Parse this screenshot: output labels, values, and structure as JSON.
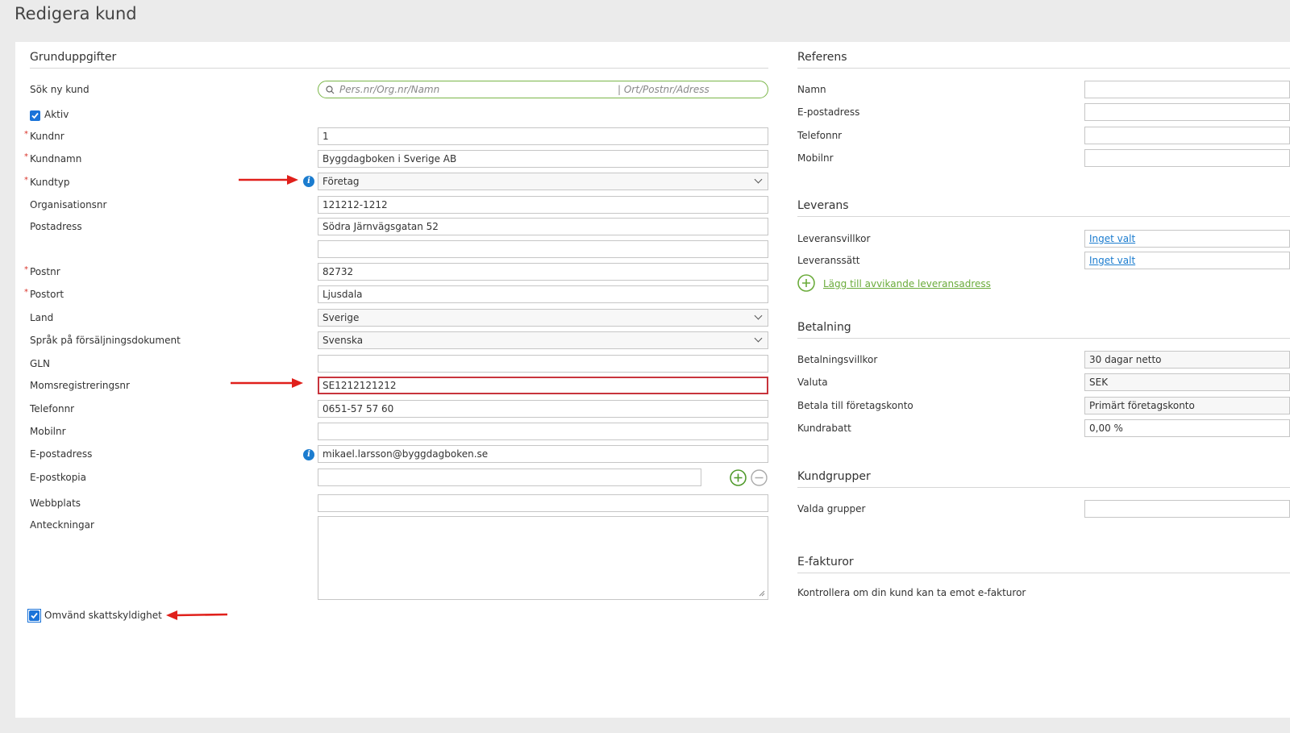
{
  "page": {
    "title": "Redigera kund"
  },
  "basic": {
    "heading": "Grunduppgifter",
    "search": {
      "label": "Sök ny kund",
      "placeholder_left": "Pers.nr/Org.nr/Namn",
      "placeholder_right": "| Ort/Postnr/Adress"
    },
    "active": {
      "label": "Aktiv",
      "checked": true
    },
    "fields": {
      "kundnr": {
        "label": "Kundnr",
        "value": "1",
        "required": "*"
      },
      "kundnamn": {
        "label": "Kundnamn",
        "value": "Byggdagboken i Sverige AB",
        "required": "*"
      },
      "kundtyp": {
        "label": "Kundtyp",
        "value": "Företag",
        "required": "*",
        "info": "i"
      },
      "orgnr": {
        "label": "Organisationsnr",
        "value": "121212-1212"
      },
      "postadress": {
        "label": "Postadress",
        "value": "Södra Järnvägsgatan 52",
        "value2": ""
      },
      "postnr": {
        "label": "Postnr",
        "value": "82732",
        "required": "*"
      },
      "postort": {
        "label": "Postort",
        "value": "Ljusdala",
        "required": "*"
      },
      "land": {
        "label": "Land",
        "value": "Sverige"
      },
      "sprak": {
        "label": "Språk på försäljningsdokument",
        "value": "Svenska"
      },
      "gln": {
        "label": "GLN",
        "value": ""
      },
      "moms": {
        "label": "Momsregistreringsnr",
        "value": "SE1212121212"
      },
      "telefon": {
        "label": "Telefonnr",
        "value": "0651-57 57 60"
      },
      "mobil": {
        "label": "Mobilnr",
        "value": ""
      },
      "epost": {
        "label": "E-postadress",
        "value": "mikael.larsson@byggdagboken.se",
        "info": "i"
      },
      "epostkopia": {
        "label": "E-postkopia",
        "value": ""
      },
      "webb": {
        "label": "Webbplats",
        "value": ""
      },
      "anteckningar": {
        "label": "Anteckningar",
        "value": ""
      }
    },
    "reverse_tax": {
      "label": "Omvänd skattskyldighet",
      "checked": true
    }
  },
  "reference": {
    "heading": "Referens",
    "fields": [
      {
        "label": "Namn",
        "value": ""
      },
      {
        "label": "E-postadress",
        "value": ""
      },
      {
        "label": "Telefonnr",
        "value": ""
      },
      {
        "label": "Mobilnr",
        "value": ""
      }
    ]
  },
  "delivery": {
    "heading": "Leverans",
    "terms": {
      "label": "Leveransvillkor",
      "value": "Inget valt"
    },
    "method": {
      "label": "Leveranssätt",
      "value": "Inget valt"
    },
    "add_address": "Lägg till avvikande leveransadress"
  },
  "payment": {
    "heading": "Betalning",
    "terms": {
      "label": "Betalningsvillkor",
      "value": "30 dagar netto"
    },
    "currency": {
      "label": "Valuta",
      "value": "SEK"
    },
    "account": {
      "label": "Betala till företagskonto",
      "value": "Primärt företagskonto"
    },
    "discount": {
      "label": "Kundrabatt",
      "value": "0,00 %"
    }
  },
  "groups": {
    "heading": "Kundgrupper",
    "selected": {
      "label": "Valda grupper",
      "value": ""
    }
  },
  "einvoice": {
    "heading": "E-fakturor",
    "text": "Kontrollera om din kund kan ta emot e-fakturor"
  },
  "colors": {
    "accent_green": "#6aab3a",
    "info_blue": "#1b7ccf",
    "error_red": "#c8343c",
    "annotation_red": "#e0201b"
  },
  "icons": [
    "search-icon",
    "info-icon",
    "chevron-down-icon",
    "plus-circle-icon",
    "minus-circle-icon",
    "checkbox-icon",
    "annotation-arrow"
  ]
}
